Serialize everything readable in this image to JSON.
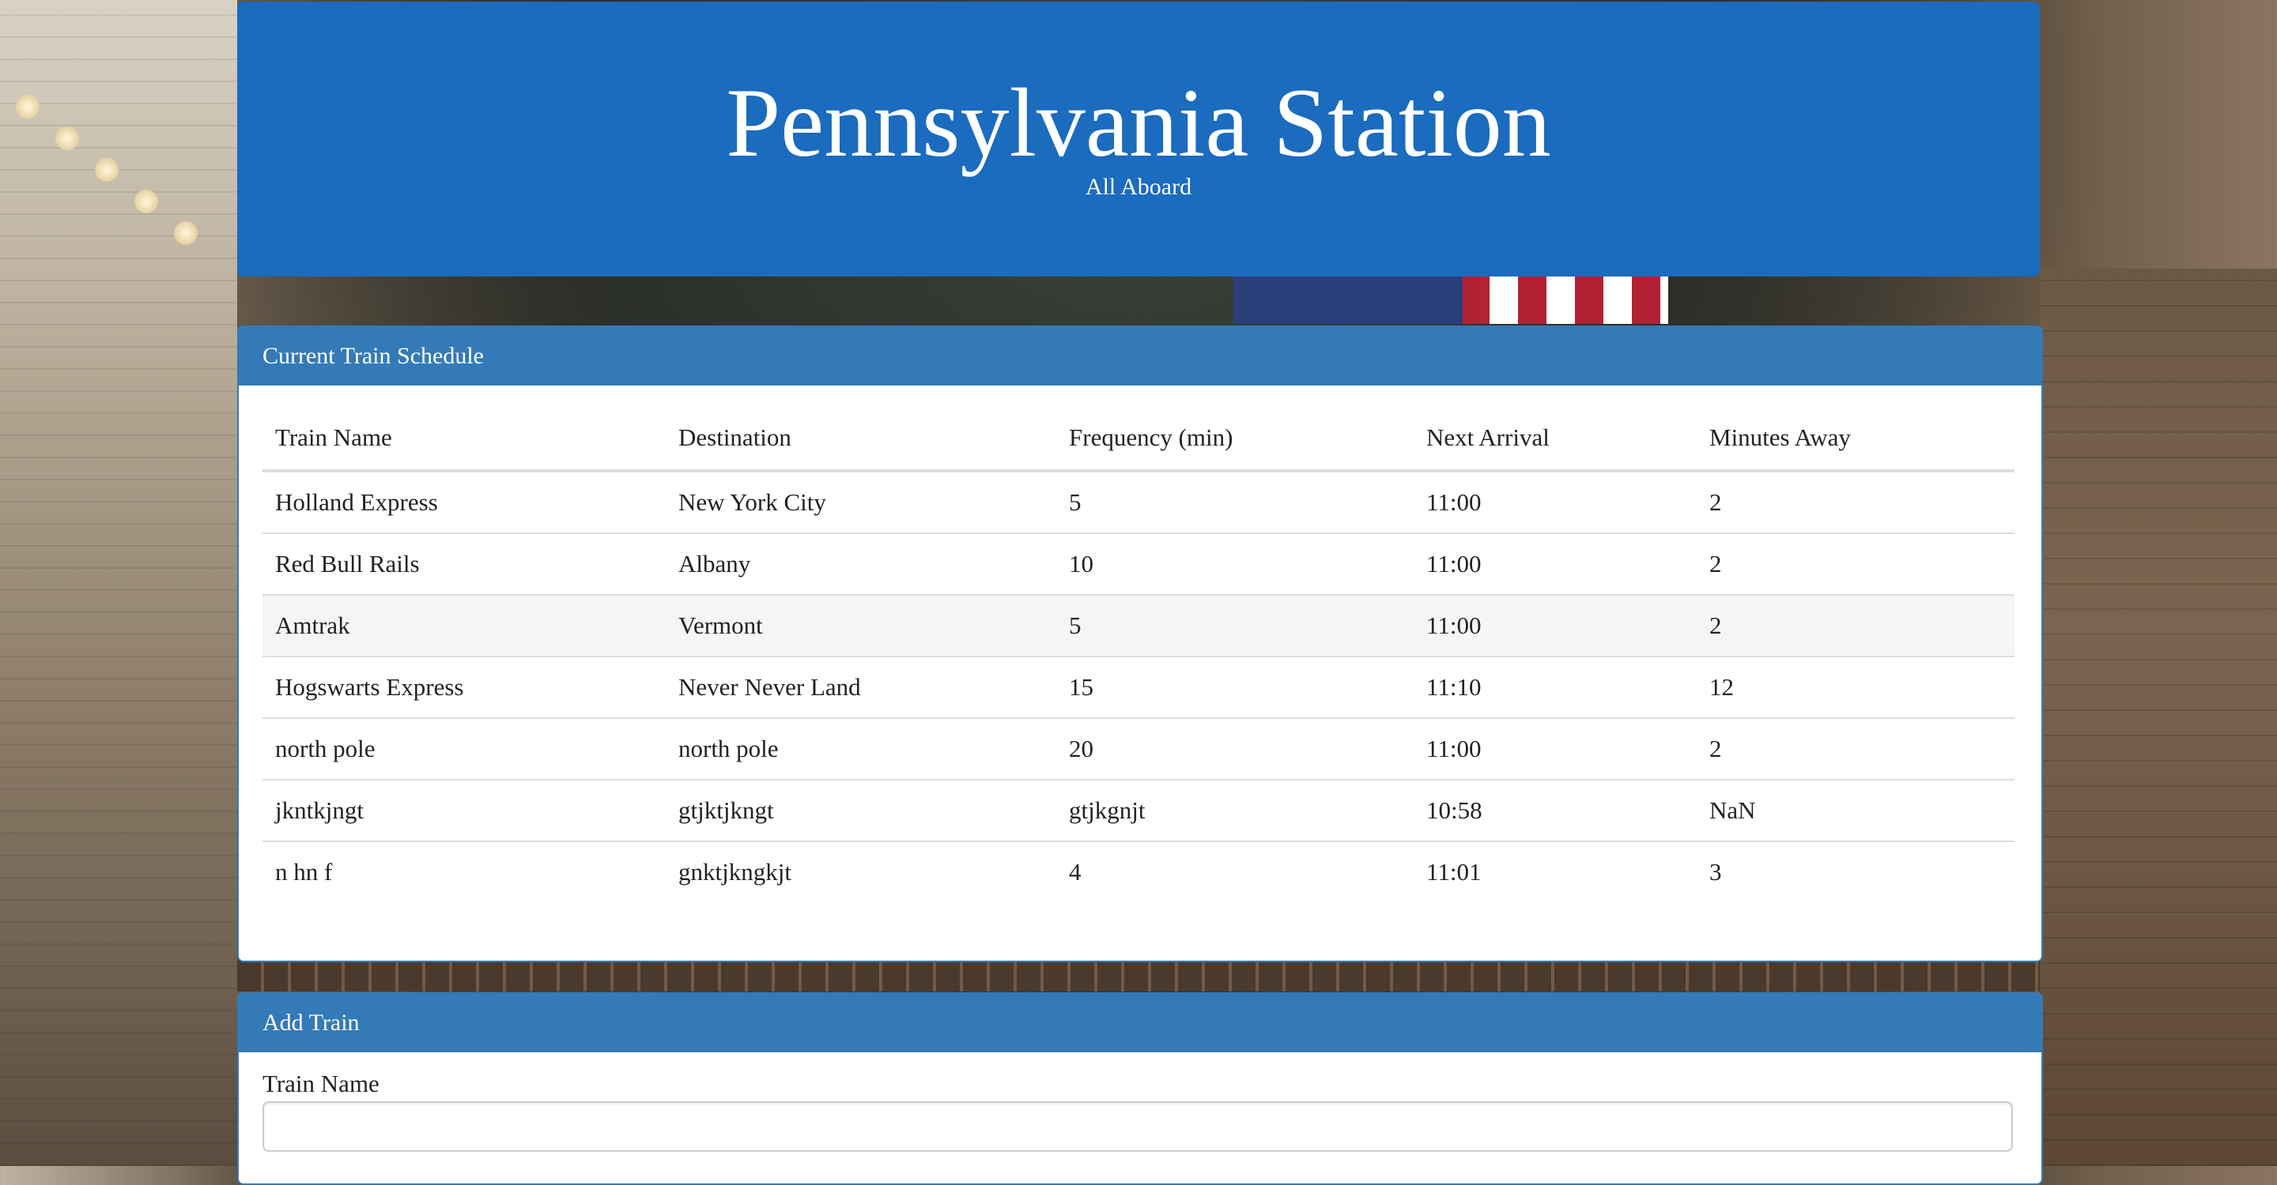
{
  "header": {
    "title": "Pennsylvania Station",
    "subtitle": "All Aboard"
  },
  "schedule": {
    "heading": "Current Train Schedule",
    "columns": [
      "Train Name",
      "Destination",
      "Frequency (min)",
      "Next Arrival",
      "Minutes Away"
    ],
    "rows": [
      [
        "Holland Express",
        "New York City",
        "5",
        "11:00",
        "2"
      ],
      [
        "Red Bull Rails",
        "Albany",
        "10",
        "11:00",
        "2"
      ],
      [
        "Amtrak",
        "Vermont",
        "5",
        "11:00",
        "2"
      ],
      [
        "Hogswarts Express",
        "Never Never Land",
        "15",
        "11:10",
        "12"
      ],
      [
        "north pole",
        "north pole",
        "20",
        "11:00",
        "2"
      ],
      [
        "jkntkjngt",
        "gtjktjkngt",
        "gtjkgnjt",
        "10:58",
        "NaN"
      ],
      [
        "n hn f",
        "gnktjkngkjt",
        "4",
        "11:01",
        "3"
      ]
    ]
  },
  "add_train": {
    "heading": "Add Train",
    "train_name_label": "Train Name",
    "train_name_value": ""
  },
  "colors": {
    "jumbotron": "#1b6bbf",
    "panel_heading": "#337ab7"
  }
}
